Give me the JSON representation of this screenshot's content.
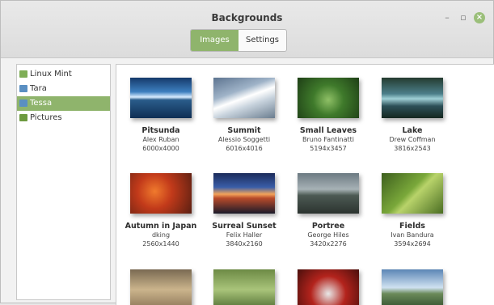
{
  "window": {
    "title": "Backgrounds",
    "minimize": "–",
    "restore": "▫",
    "close": "×"
  },
  "tabs": [
    {
      "label": "Images",
      "active": true
    },
    {
      "label": "Settings",
      "active": false
    }
  ],
  "sidebar": {
    "items": [
      {
        "label": "Linux Mint",
        "icon": "folder-icon-green",
        "selected": false
      },
      {
        "label": "Tara",
        "icon": "folder-icon-blue",
        "selected": false
      },
      {
        "label": "Tessa",
        "icon": "folder-icon-blue",
        "selected": true
      },
      {
        "label": "Pictures",
        "icon": "pictures-folder-icon",
        "selected": false
      }
    ]
  },
  "grid": [
    {
      "name": "Pitsunda",
      "author": "Alex Ruban",
      "size": "6000x4000"
    },
    {
      "name": "Summit",
      "author": "Alessio Soggetti",
      "size": "6016x4016"
    },
    {
      "name": "Small Leaves",
      "author": "Bruno Fantinatti",
      "size": "5194x3457"
    },
    {
      "name": "Lake",
      "author": "Drew Coffman",
      "size": "3816x2543"
    },
    {
      "name": "Autumn in Japan",
      "author": "dking",
      "size": "2560x1440"
    },
    {
      "name": "Surreal Sunset",
      "author": "Felix Haller",
      "size": "3840x2160"
    },
    {
      "name": "Portree",
      "author": "George Hiles",
      "size": "3420x2276"
    },
    {
      "name": "Fields",
      "author": "Ivan Bandura",
      "size": "3594x2694"
    }
  ],
  "colors": {
    "accent": "#8fb46c",
    "close_button": "#9bbf7a"
  }
}
